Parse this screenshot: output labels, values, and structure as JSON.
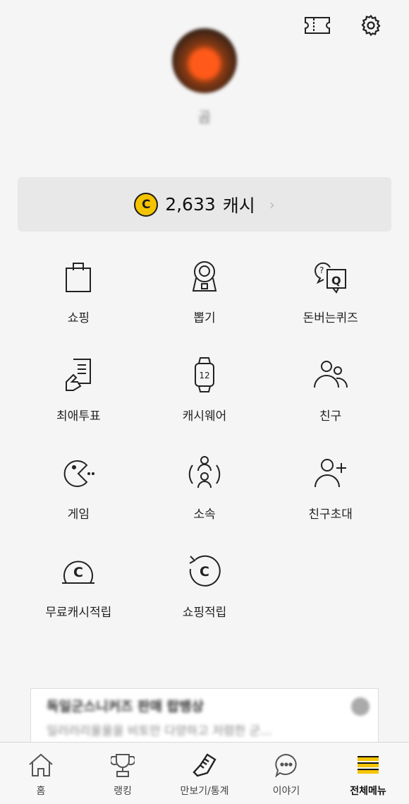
{
  "profile": {
    "nickname": "곰"
  },
  "cash": {
    "coin_symbol": "C",
    "amount": "2,633",
    "unit": "캐시",
    "chevron": "›",
    "coin_color": "#f5c400"
  },
  "menu": [
    {
      "label": "쇼핑",
      "icon": "shopping-bag-icon"
    },
    {
      "label": "뽑기",
      "icon": "gacha-machine-icon"
    },
    {
      "label": "돈버는퀴즈",
      "icon": "quiz-icon"
    },
    {
      "label": "최애투표",
      "icon": "vote-icon"
    },
    {
      "label": "캐시웨어",
      "icon": "smartwatch-icon",
      "watch_text": "12"
    },
    {
      "label": "친구",
      "icon": "friends-icon"
    },
    {
      "label": "게임",
      "icon": "pacman-icon"
    },
    {
      "label": "소속",
      "icon": "group-icon"
    },
    {
      "label": "친구초대",
      "icon": "invite-friend-icon"
    },
    {
      "label": "무료캐시적립",
      "icon": "free-cash-icon",
      "coin_text": "C"
    },
    {
      "label": "쇼핑적립",
      "icon": "shopping-reward-icon",
      "coin_text": "C"
    }
  ],
  "banner": {
    "title": "독일군스니커즈 판매 랍뱅상",
    "subtitle": "일러러리울울을 비토만 다양하고 저렴한 군..."
  },
  "tabs": [
    {
      "label": "홈",
      "icon": "home-icon",
      "active": false
    },
    {
      "label": "랭킹",
      "icon": "trophy-icon",
      "active": false
    },
    {
      "label": "만보기/통계",
      "icon": "shoe-icon",
      "active": false
    },
    {
      "label": "이야기",
      "icon": "chat-bubble-icon",
      "active": false
    },
    {
      "label": "전체메뉴",
      "icon": "menu-icon",
      "active": true,
      "accent": "#f5c400"
    }
  ]
}
